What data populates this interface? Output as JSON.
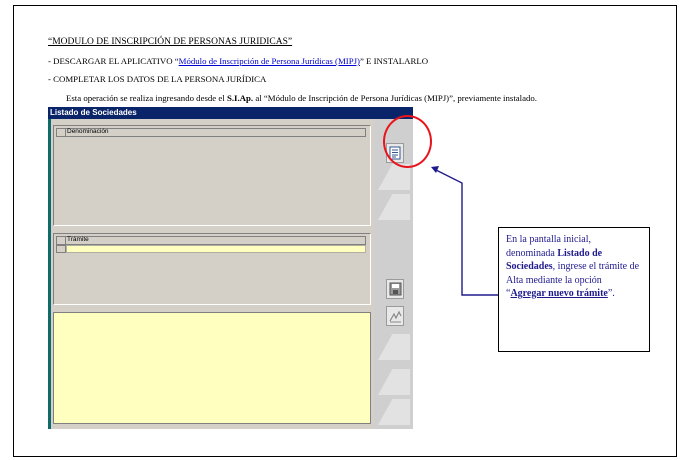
{
  "document": {
    "title": "“MODULO DE INSCRIPCIÓN DE PERSONAS JURIDICAS”",
    "line1_prefix": "- DESCARGAR EL APLICATIVO “",
    "line1_link": "Módulo de Inscripción de Persona Jurídicas (MIPJ)",
    "line1_suffix": "” E INSTALARLO",
    "line2": "- COMPLETAR LOS DATOS DE LA PERSONA JURÍDICA",
    "line3_prefix": "Esta operación se realiza ingresando desde el ",
    "line3_bold": "S.I.Ap.",
    "line3_suffix": " al “Módulo de Inscripción de Persona Jurídicas (MIPJ)”, previamente instalado."
  },
  "app": {
    "window_title": "Listado de Sociedades",
    "col_denominacion": "Denominación",
    "col_tramite": "Trámite",
    "colors": {
      "titlebar": "#0a246a",
      "yellow": "#ffffc0"
    }
  },
  "annotation": {
    "circle_color": "#e8141c",
    "arrow_color": "#1f1a8c",
    "text_1": "En la pantalla inicial, denominada ",
    "bold_1": "Listado de Sociedades",
    "text_2": ", ingrese el trámite de Alta mediante la opción “",
    "link": "Agregar nuevo trámite",
    "text_3": "”."
  },
  "icons": [
    "add-document-icon",
    "floppy-disk-icon",
    "signature-icon"
  ]
}
